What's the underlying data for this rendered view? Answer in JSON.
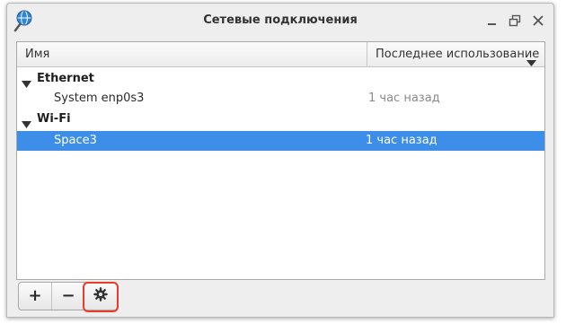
{
  "window": {
    "title": "Сетевые подключения"
  },
  "columns": {
    "name": "Имя",
    "last_used": "Последнее использование"
  },
  "groups": [
    {
      "label": "Ethernet",
      "connections": [
        {
          "name": "System enp0s3",
          "last_used": "1 час назад"
        }
      ]
    },
    {
      "label": "Wi-Fi",
      "connections": [
        {
          "name": "Space3",
          "last_used": "1 час назад",
          "selected": true
        }
      ]
    }
  ],
  "toolbar": {
    "add_label": "+",
    "remove_label": "−"
  },
  "icons": {
    "app": "network-connections-icon",
    "minimize": "minimize-icon",
    "maximize": "maximize-icon",
    "close": "close-icon",
    "sort": "sort-descending-icon",
    "expander": "expander-triangle-icon",
    "settings": "gear-icon"
  },
  "colors": {
    "selection": "#3d8ee8",
    "highlight": "#ee3a2a",
    "muted_text": "#8a8a8a"
  }
}
